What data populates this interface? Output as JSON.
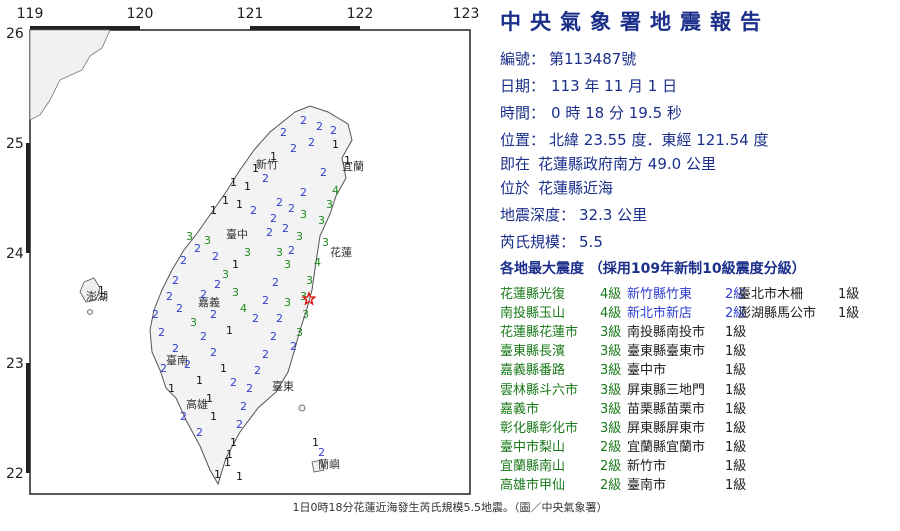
{
  "map": {
    "lon_ticks": [
      "119",
      "120",
      "121",
      "122",
      "123"
    ],
    "lat_ticks": [
      "26",
      "25",
      "24",
      "23",
      "22"
    ],
    "place_labels": [
      "新竹",
      "宜蘭",
      "臺中",
      "花蓮",
      "澎湖",
      "嘉義",
      "臺南",
      "高雄",
      "臺東",
      "蘭嶼"
    ],
    "epicenter_icon": "red-star-icon",
    "colors": {
      "intensity_1": "#111111",
      "intensity_2": "#2f3ecf",
      "intensity_3": "#1f8a1f",
      "intensity_4": "#1f8a1f",
      "coast": "#555555",
      "epicenter": "#e01010"
    }
  },
  "panel": {
    "title": "中央氣象署地震報告",
    "number_label": "編號：",
    "number_value": "第113487號",
    "date_label": "日期：",
    "date_value": "113 年 11 月 1 日",
    "time_label": "時間：",
    "time_value": "0 時 18 分 19.5 秒",
    "location_label": "位置：",
    "location_value": "北緯 23.55 度．東經 121.54 度",
    "at_label": "即在",
    "at_value": "花蓮縣政府南方 49.0 公里",
    "region_label": "位於",
    "region_value": "花蓮縣近海",
    "depth_label": "地震深度：",
    "depth_value": "32.3 公里",
    "magnitude_label": "芮氏規模：",
    "magnitude_value": "5.5",
    "intensity_heading": "各地最大震度 （採用109年新制10級震度分級）"
  },
  "intensity_table": [
    [
      {
        "place": "花蓮縣光復",
        "level": "4級",
        "color": "green"
      },
      {
        "place": "新竹縣竹東",
        "level": "2級",
        "color": "blue"
      },
      {
        "place": "臺北市木柵",
        "level": "1級",
        "color": "dark"
      }
    ],
    [
      {
        "place": "南投縣玉山",
        "level": "4級",
        "color": "green"
      },
      {
        "place": "新北市新店",
        "level": "2級",
        "color": "blue"
      },
      {
        "place": "澎湖縣馬公市",
        "level": "1級",
        "color": "dark"
      }
    ],
    [
      {
        "place": "花蓮縣花蓮市",
        "level": "3級",
        "color": "green"
      },
      {
        "place": "南投縣南投市",
        "level": "1級",
        "color": "dark"
      }
    ],
    [
      {
        "place": "臺東縣長濱",
        "level": "3級",
        "color": "green"
      },
      {
        "place": "臺東縣臺東市",
        "level": "1級",
        "color": "dark"
      }
    ],
    [
      {
        "place": "嘉義縣番路",
        "level": "3級",
        "color": "green"
      },
      {
        "place": "臺中市",
        "level": "1級",
        "color": "dark"
      }
    ],
    [
      {
        "place": "雲林縣斗六市",
        "level": "3級",
        "color": "green"
      },
      {
        "place": "屏東縣三地門",
        "level": "1級",
        "color": "dark"
      }
    ],
    [
      {
        "place": "嘉義市",
        "level": "3級",
        "color": "green"
      },
      {
        "place": "苗栗縣苗栗市",
        "level": "1級",
        "color": "dark"
      }
    ],
    [
      {
        "place": "彰化縣彰化市",
        "level": "3級",
        "color": "green"
      },
      {
        "place": "屏東縣屏東市",
        "level": "1級",
        "color": "dark"
      }
    ],
    [
      {
        "place": "臺中市梨山",
        "level": "2級",
        "color": "blue"
      },
      {
        "place": "宜蘭縣宜蘭市",
        "level": "1級",
        "color": "dark"
      }
    ],
    [
      {
        "place": "宜蘭縣南山",
        "level": "2級",
        "color": "blue"
      },
      {
        "place": "新竹市",
        "level": "1級",
        "color": "dark"
      }
    ],
    [
      {
        "place": "高雄市甲仙",
        "level": "2級",
        "color": "blue"
      },
      {
        "place": "臺南市",
        "level": "1級",
        "color": "dark"
      }
    ]
  ],
  "caption": "1日0時18分花蓮近海發生芮氏規模5.5地震。（圖／中央氣象署）",
  "colors": {
    "title": "#1b2f8a",
    "green": "#1a7a1a",
    "blue": "#2f3ecf",
    "dark": "#222222"
  }
}
